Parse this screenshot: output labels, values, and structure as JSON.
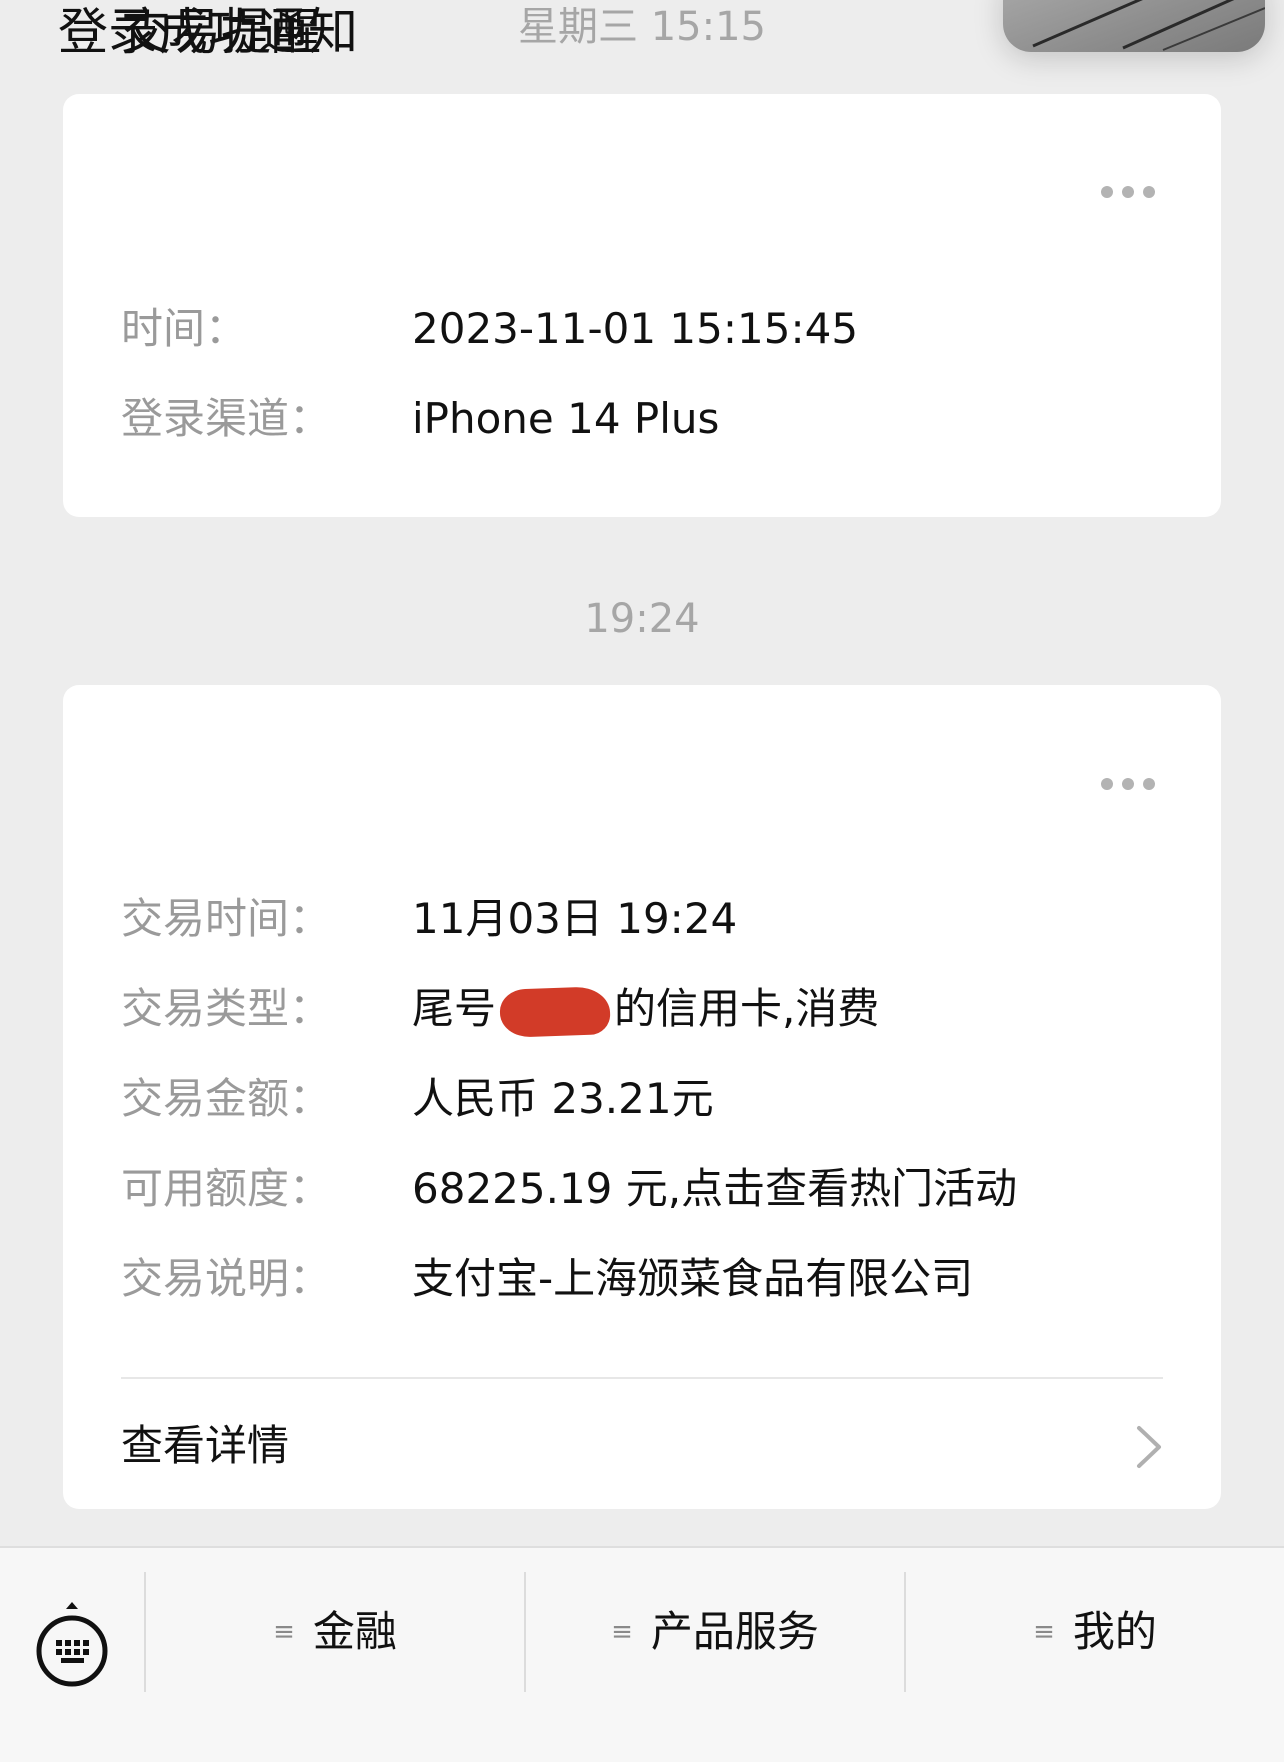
{
  "timestamps": {
    "first": "星期三 15:15",
    "second": "19:24"
  },
  "login_card": {
    "title": "登录成功通知",
    "rows": [
      {
        "label": "时间：",
        "value": "2023-11-01 15:15:45"
      },
      {
        "label": "登录渠道：",
        "value": "iPhone 14 Plus"
      }
    ]
  },
  "transaction_card": {
    "title": "交易提醒",
    "time_label": "交易时间：",
    "time_value": "11月03日 19:24",
    "type_label": "交易类型：",
    "type_prefix": "尾号",
    "type_suffix": "的信用卡,消费",
    "amount_label": "交易金额：",
    "amount_value": "人民币 23.21元",
    "credit_label": "可用额度：",
    "credit_value": "68225.19 元,点击查看热门活动",
    "desc_label": "交易说明：",
    "desc_value": "支付宝-上海颁菜食品有限公司",
    "details_label": "查看详情"
  },
  "bottom_menu": {
    "items": [
      {
        "label": "金融"
      },
      {
        "label": "产品服务"
      },
      {
        "label": "我的"
      }
    ]
  },
  "icons": {
    "more": "more-dots-icon",
    "chevron": "chevron-right-icon",
    "keyboard": "keyboard-icon",
    "menu": "menu-lines-icon"
  },
  "colors": {
    "background": "#ededed",
    "card": "#ffffff",
    "label_gray": "#9a9a9a",
    "redaction": "#d23b28"
  }
}
